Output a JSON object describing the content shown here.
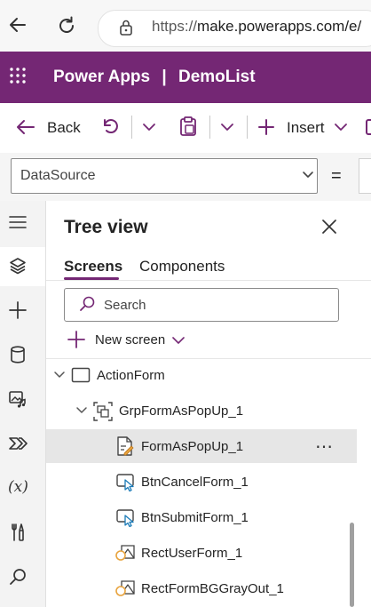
{
  "browser": {
    "url_prefix": "https://",
    "url_host": "make.powerapps.com/e/"
  },
  "header": {
    "product": "Power Apps",
    "separator": "|",
    "app_name": "DemoList"
  },
  "commands": {
    "back": "Back",
    "insert": "Insert"
  },
  "formula_bar": {
    "property": "DataSource",
    "equals": "="
  },
  "left_rail": {
    "icons": [
      "hamburger-icon",
      "layers-icon",
      "plus-icon",
      "database-icon",
      "media-icon",
      "power-automate-icon",
      "variables-icon",
      "tools-icon",
      "search-icon"
    ],
    "variables_label": "(x)"
  },
  "tree_view": {
    "title": "Tree view",
    "tabs": [
      "Screens",
      "Components"
    ],
    "active_tab": "Screens",
    "search_placeholder": "Search",
    "new_screen": "New screen",
    "nodes": [
      {
        "label": "ActionForm",
        "icon": "screen-icon",
        "level": 0
      },
      {
        "label": "GrpFormAsPopUp_1",
        "icon": "group-icon",
        "level": 1
      },
      {
        "label": "FormAsPopUp_1",
        "icon": "form-icon",
        "level": 2,
        "selected": true,
        "more": "⋯"
      },
      {
        "label": "BtnCancelForm_1",
        "icon": "button-icon",
        "level": 2
      },
      {
        "label": "BtnSubmitForm_1",
        "icon": "button-icon",
        "level": 2
      },
      {
        "label": "RectUserForm_1",
        "icon": "shape-icon",
        "level": 2
      },
      {
        "label": "RectFormBGGrayOut_1",
        "icon": "shape-icon",
        "level": 2
      }
    ]
  },
  "colors": {
    "brand": "#742774",
    "selected_row": "#e6e6e6",
    "icon_accent": "#e8a33d"
  }
}
